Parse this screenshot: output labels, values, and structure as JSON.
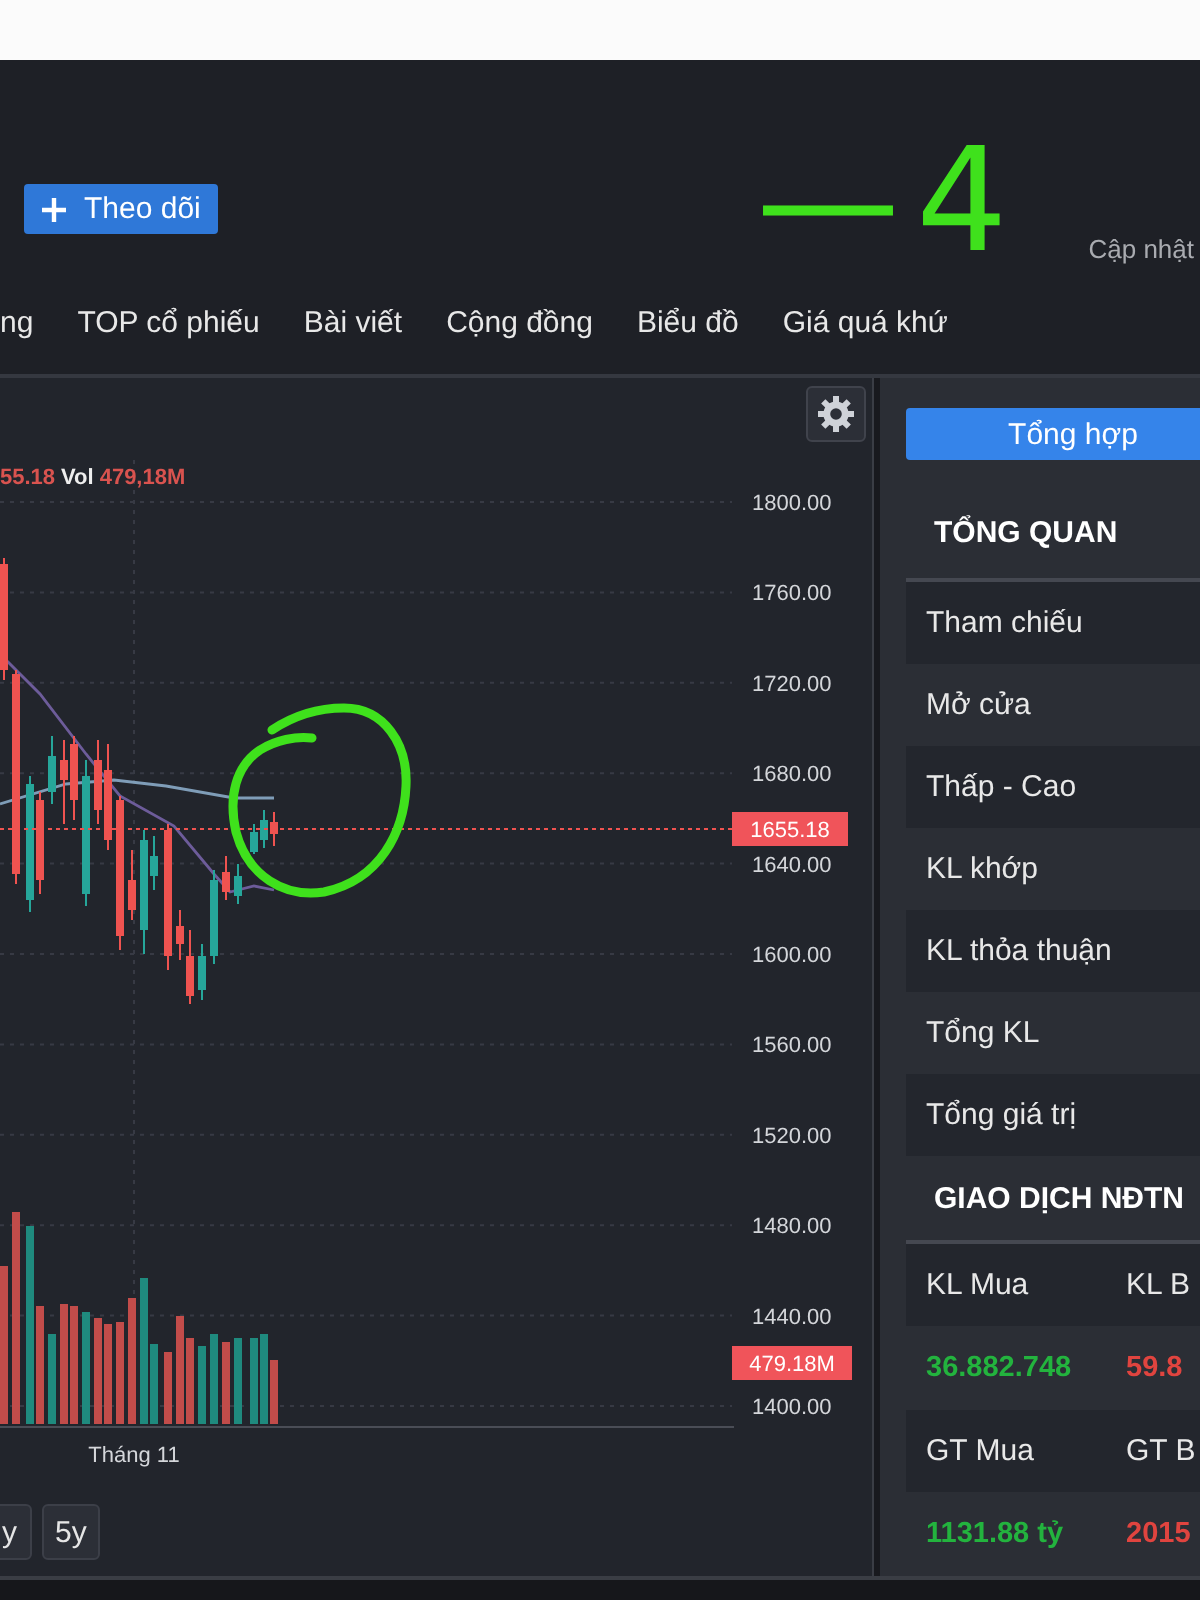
{
  "header": {
    "follow_button": {
      "label": "Theo dõi"
    },
    "handwritten_note": "—4",
    "update_label": "Cập nhật"
  },
  "nav_links": [
    "ng",
    "TOP cổ phiếu",
    "Bài viết",
    "Cộng đồng",
    "Biểu đồ",
    "Giá quá khứ"
  ],
  "chart": {
    "legend": {
      "close": "55.18",
      "volume_label": "Vol",
      "volume_value": "479,18M"
    },
    "y_axis_labels": [
      "1800.00",
      "1760.00",
      "1720.00",
      "1680.00",
      "1640.00",
      "1600.00",
      "1560.00",
      "1520.00",
      "1480.00",
      "1440.00",
      "1400.00"
    ],
    "price_tag": "1655.18",
    "volume_tag": "479.18M",
    "x_axis_labels": [
      "Tháng 11"
    ],
    "range_buttons": [
      {
        "label": "y",
        "selected": false
      },
      {
        "label": "5y",
        "selected": false
      }
    ]
  },
  "summary_panel": {
    "tabs": [
      {
        "label": "Tổng hợp",
        "selected": true
      }
    ],
    "overview": {
      "title": "TỔNG QUAN",
      "rows": [
        "Tham chiếu",
        "Mở cửa",
        "Thấp - Cao",
        "KL khớp",
        "KL thỏa thuận",
        "Tổng KL",
        "Tổng giá trị"
      ]
    },
    "foreign_trading": {
      "title": "GIAO DỊCH NĐTN",
      "rows": [
        {
          "items": [
            {
              "label": "KL Mua",
              "value": "36.882.748",
              "color": "#23b33e"
            },
            {
              "label": "KL B",
              "value": "59.8",
              "color": "#e0443f"
            }
          ]
        },
        {
          "items": [
            {
              "label": "GT Mua",
              "value": "1131.88 tỷ",
              "color": "#23b33e"
            },
            {
              "label": "GT B",
              "value": "2015",
              "color": "#e0443f"
            }
          ]
        }
      ]
    }
  }
}
